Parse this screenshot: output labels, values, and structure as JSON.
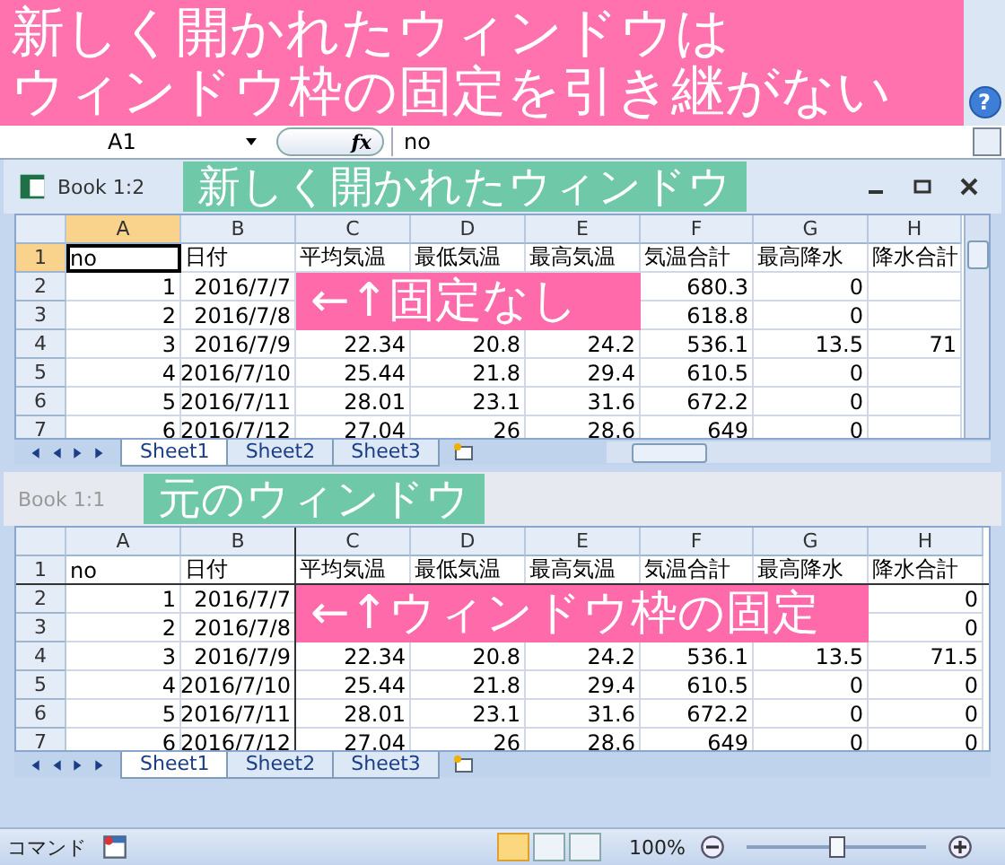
{
  "banner": {
    "lines": [
      "新しく開かれたウィンドウは",
      "ウィンドウ枠の固定を引き継がない"
    ]
  },
  "help": "?",
  "formula_bar": {
    "name_box": "A1",
    "function_label": "fx",
    "formula": "no"
  },
  "windows": [
    {
      "title": "Book 1:2",
      "label": "新しく開かれたウィンドウ",
      "active": true,
      "frozen": false,
      "scrollbars": true,
      "annotation": "←↑固定なし",
      "columns": [
        "A",
        "B",
        "C",
        "D",
        "E",
        "F",
        "G",
        "H"
      ],
      "row_headers": [
        "1",
        "2",
        "3",
        "4",
        "5",
        "6",
        "7"
      ],
      "rows": [
        [
          "no",
          "日付",
          "平均気温",
          "最低気温",
          "最高気温",
          "気温合計",
          "最高降水",
          "降水合計"
        ],
        [
          "1",
          "2016/7/7",
          null,
          null,
          null,
          "680.3",
          "0"
        ],
        [
          "2",
          "2016/7/8",
          null,
          null,
          null,
          "618.8",
          "0"
        ],
        [
          "3",
          "2016/7/9",
          "22.34",
          "20.8",
          "24.2",
          "536.1",
          "13.5",
          "71"
        ],
        [
          "4",
          "2016/7/10",
          "25.44",
          "21.8",
          "29.4",
          "610.5",
          "0"
        ],
        [
          "5",
          "2016/7/11",
          "28.01",
          "23.1",
          "31.6",
          "672.2",
          "0"
        ],
        [
          "6",
          "2016/7/12",
          "27.04",
          "26",
          "28.6",
          "649",
          "0"
        ]
      ],
      "sheets": [
        {
          "label": "Sheet1",
          "selected": true
        },
        {
          "label": "Sheet2",
          "selected": false
        },
        {
          "label": "Sheet3",
          "selected": false
        }
      ]
    },
    {
      "title": "Book 1:1",
      "label": "元のウィンドウ",
      "active": false,
      "frozen": true,
      "scrollbars": false,
      "annotation": "←↑ウィンドウ枠の固定",
      "columns": [
        "A",
        "B",
        "C",
        "D",
        "E",
        "F",
        "G",
        "H"
      ],
      "row_headers": [
        "1",
        "2",
        "3",
        "4",
        "5",
        "6",
        "7"
      ],
      "rows": [
        [
          "no",
          "日付",
          "平均気温",
          "最低気温",
          "最高気温",
          "気温合計",
          "最高降水",
          "降水合計"
        ],
        [
          "1",
          "2016/7/7",
          null,
          null,
          null,
          null,
          null,
          "0"
        ],
        [
          "2",
          "2016/7/8",
          null,
          null,
          null,
          null,
          null,
          "0"
        ],
        [
          "3",
          "2016/7/9",
          "22.34",
          "20.8",
          "24.2",
          "536.1",
          "13.5",
          "71.5"
        ],
        [
          "4",
          "2016/7/10",
          "25.44",
          "21.8",
          "29.4",
          "610.5",
          "0",
          "0"
        ],
        [
          "5",
          "2016/7/11",
          "28.01",
          "23.1",
          "31.6",
          "672.2",
          "0",
          "0"
        ],
        [
          "6",
          "2016/7/12",
          "27.04",
          "26",
          "28.6",
          "649",
          "0",
          "0"
        ]
      ],
      "sheets": [
        {
          "label": "Sheet1",
          "selected": true
        },
        {
          "label": "Sheet2",
          "selected": false
        },
        {
          "label": "Sheet3",
          "selected": false
        }
      ]
    }
  ],
  "status_bar": {
    "mode": "コマンド",
    "views": [
      {
        "selected": true
      },
      {
        "selected": false
      },
      {
        "selected": false
      }
    ],
    "zoom": "100%",
    "zoom_slider": {
      "level": 0.5
    }
  }
}
